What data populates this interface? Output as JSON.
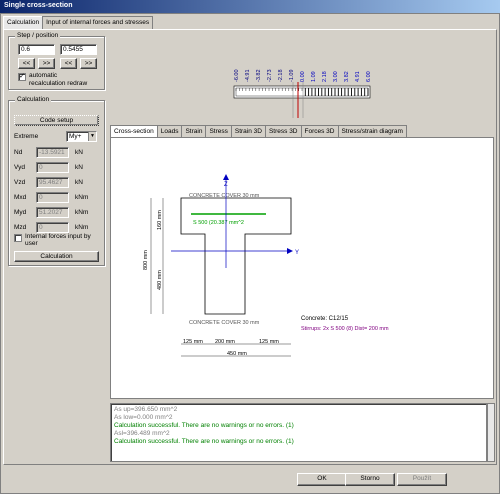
{
  "window": {
    "title": "Single cross-section"
  },
  "tabs": [
    {
      "label": "Calculation"
    },
    {
      "label": "Input of internal forces and stresses"
    }
  ],
  "step_position": {
    "title": "Step / position",
    "step_value": "0.6",
    "position_value": "0.5455",
    "nav_buttons": [
      "<<",
      ">>",
      "<<",
      ">>"
    ],
    "auto_recalc_label_1": "automatic",
    "auto_recalc_label_2": "recalculation redraw",
    "auto_recalc_checked": "✓"
  },
  "calculation": {
    "title": "Calculation",
    "code_setup": "Code setup",
    "extreme_label": "Extreme",
    "extreme_value": "My+",
    "forces": [
      {
        "label": "Nd",
        "value": "-13.5921",
        "unit": "kN"
      },
      {
        "label": "Vyd",
        "value": "0",
        "unit": "kN"
      },
      {
        "label": "Vzd",
        "value": "95.4627",
        "unit": "kN"
      },
      {
        "label": "Mxd",
        "value": "0",
        "unit": "kNm"
      },
      {
        "label": "Myd",
        "value": "51.2027",
        "unit": "kNm"
      },
      {
        "label": "Mzd",
        "value": "0",
        "unit": "kNm"
      }
    ],
    "internal_forces_label_1": "Internal forces input by",
    "internal_forces_label_2": "user",
    "calc_button": "Calculation"
  },
  "diagram_values": [
    "-6.00",
    "-4.91",
    "-3.82",
    "-2.73",
    "-2.18",
    "-1.09",
    "0.00",
    "1.09",
    "2.18",
    "3.00",
    "3.82",
    "4.91",
    "6.00"
  ],
  "subtabs": [
    "Cross-section",
    "Loads",
    "Strain",
    "Stress",
    "Strain 3D",
    "Stress 3D",
    "Forces 3D",
    "Stress/strain diagram"
  ],
  "section": {
    "cover_top": "CONCRETE COVER 30 mm",
    "cover_bottom": "CONCRETE COVER 30 mm",
    "rebar_label": "S 500 (20.387 mm^2",
    "axis_z": "Z",
    "axis_y": "Y",
    "dim_flange_h": "160 mm",
    "dim_total_h": "800 mm",
    "dim_web_h": "480 mm",
    "dim_left": "125 mm",
    "dim_web": "200 mm",
    "dim_right": "125 mm",
    "dim_total_w": "450 mm",
    "concrete": "Concrete: C12/15",
    "stirrups": "Stirrups: 2x S 500 (8) Dist= 200 mm",
    "colors": {
      "rebar": "#00a000",
      "axis": "#0000c0",
      "stirrups": "#800080",
      "zero_line": "#c00000"
    }
  },
  "log": [
    {
      "text": "As up=396.650 mm^2",
      "kind": "gray"
    },
    {
      "text": "As low=0.000 mm^2",
      "kind": "gray"
    },
    {
      "text": "Calculation successful. There are no warnings or no errors. (1)",
      "kind": "green"
    },
    {
      "text": "Asl=396.489 mm^2",
      "kind": "gray"
    },
    {
      "text": "Calculation successful. There are no warnings or no errors. (1)",
      "kind": "green"
    }
  ],
  "footer": {
    "ok": "OK",
    "storno": "Storno",
    "apply": "Použít"
  }
}
